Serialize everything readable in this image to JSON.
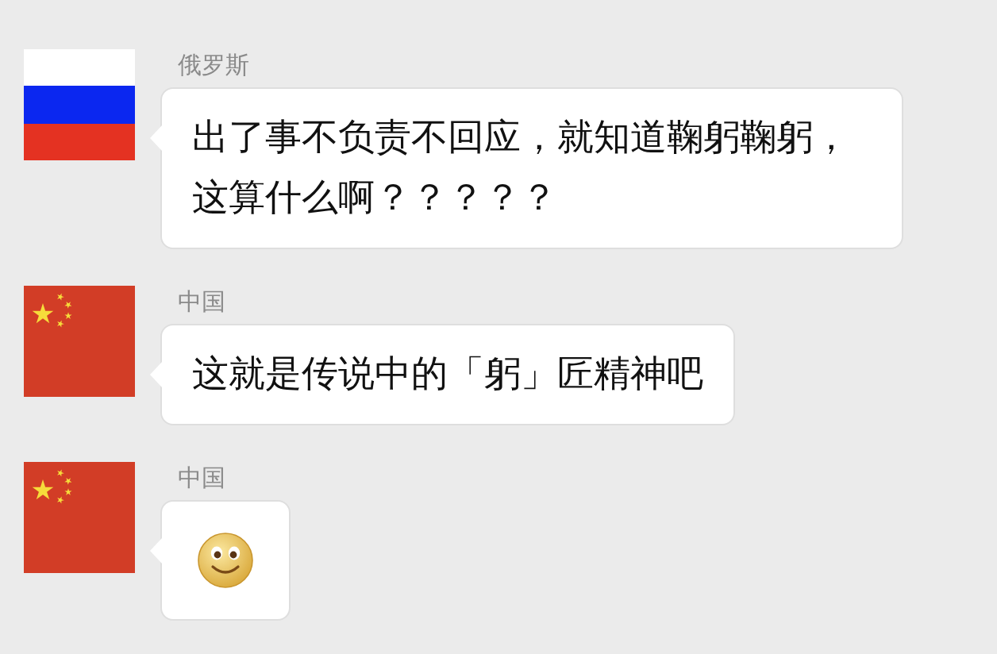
{
  "messages": [
    {
      "sender": "俄罗斯",
      "avatar": {
        "kind": "tricolor"
      },
      "kind": "text",
      "text": "出了事不负责不回应，就知道鞠躬鞠躬，这算什么啊？？？？？"
    },
    {
      "sender": "中国",
      "avatar": {
        "kind": "stars"
      },
      "kind": "text",
      "text": "这就是传说中的「躬」匠精神吧"
    },
    {
      "sender": "中国",
      "avatar": {
        "kind": "stars"
      },
      "kind": "emoji"
    }
  ]
}
